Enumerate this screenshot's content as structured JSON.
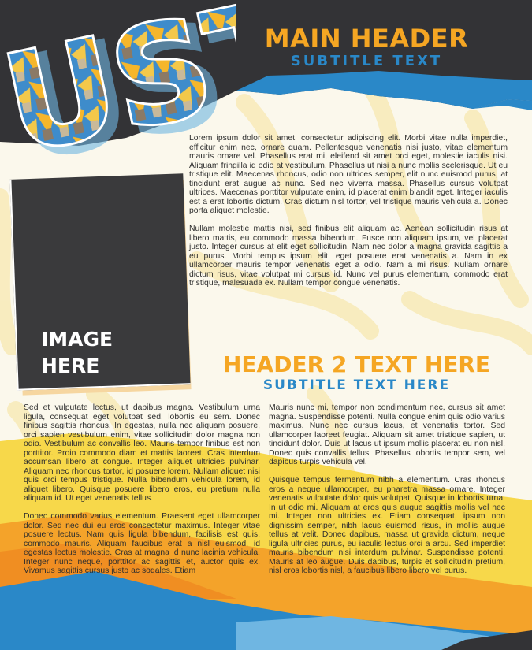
{
  "colors": {
    "accent_orange": "#f5a623",
    "accent_blue": "#2a88c8",
    "dark": "#333336",
    "background": "#fbf8ec"
  },
  "logo": {
    "text": "UST"
  },
  "header": {
    "title": "MAIN HEADER",
    "subtitle": "SUBTITLE TEXT"
  },
  "intro": {
    "paragraph1": "Lorem ipsum dolor sit amet, consectetur adipiscing elit. Morbi vitae nulla imperdiet, efficitur enim nec, ornare quam. Pellentesque venenatis nisi justo, vitae elementum mauris ornare vel. Phasellus erat mi, eleifend sit amet orci eget, molestie iaculis nisi. Aliquam fringilla id odio at vestibulum. Phasellus ut nisi a nunc mollis scelerisque. Ut eu tristique elit. Maecenas rhoncus, odio non ultrices semper, elit nunc euismod purus, at tincidunt erat augue ac nunc. Sed nec viverra massa. Phasellus cursus volutpat ultrices. Maecenas porttitor vulputate enim, id placerat enim blandit eget. Integer iaculis est a erat lobortis dictum. Cras dictum nisl tortor, vel tristique mauris vehicula a. Donec porta aliquet molestie.",
    "paragraph2": "Nullam molestie mattis nisi, sed finibus elit aliquam ac. Aenean sollicitudin risus at libero mattis, eu commodo massa bibendum. Fusce non aliquam ipsum, vel placerat justo. Integer cursus at elit eget sollicitudin. Nam nec dolor a magna gravida sagittis a eu purus. Morbi tempus ipsum elit, eget posuere erat venenatis a. Nam in ex ullamcorper mauris tempor venenatis eget a odio. Nam a mi risus. Nullam ornare dictum risus, vitae volutpat mi cursus id. Nunc vel purus elementum, commodo erat tristique, malesuada ex. Nullam tempor congue venenatis."
  },
  "image_placeholder": {
    "line1": "IMAGE",
    "line2": "HERE"
  },
  "header2": {
    "title": "HEADER 2 TEXT HERE",
    "subtitle": "SUBTITLE TEXT HERE"
  },
  "left_column": {
    "paragraph1": "Sed et vulputate lectus, ut dapibus magna. Vestibulum urna ligula, consequat eget volutpat sed, lobortis eu sem. Donec finibus sagittis rhoncus. In egestas, nulla nec aliquam posuere, orci sapien vestibulum enim, vitae sollicitudin dolor magna non odio. Vestibulum ac convallis leo. Mauris tempor finibus est non porttitor. Proin commodo diam et mattis laoreet. Cras interdum accumsan libero at congue. Integer aliquet ultricies pulvinar. Aliquam nec rhoncus tortor, id posuere lorem. Nullam aliquet nisi quis orci tempus tristique. Nulla bibendum vehicula lorem, id aliquet libero. Quisque posuere libero eros, eu pretium nulla aliquam id. Ut eget venenatis tellus.",
    "paragraph2": "Donec commodo varius elementum. Praesent eget ullamcorper dolor. Sed nec dui eu eros consectetur maximus. Integer vitae posuere lectus. Nam quis ligula bibendum, facilisis est quis, commodo mauris. Aliquam faucibus erat a nisl euismod, id egestas lectus molestie. Cras at magna id nunc lacinia vehicula. Integer nunc neque, porttitor ac sagittis et, auctor quis ex. Vivamus sagittis cursus justo ac sodales. Etiam"
  },
  "right_column": {
    "paragraph1": "Mauris nunc mi, tempor non condimentum nec, cursus sit amet magna. Suspendisse potenti. Nulla congue enim quis odio varius maximus. Nunc nec cursus lacus, et venenatis tortor. Sed ullamcorper laoreet feugiat. Aliquam sit amet tristique sapien, ut tincidunt dolor. Duis ut lacus ut ipsum mollis placerat eu non nisl. Donec quis convallis tellus. Phasellus lobortis tempor sem, vel dapibus turpis vehicula vel.",
    "paragraph2": "Quisque tempus fermentum nibh a elementum. Cras rhoncus eros a neque ullamcorper, eu pharetra massa ornare. Integer venenatis vulputate dolor quis volutpat. Quisque in lobortis urna. In ut odio mi. Aliquam at eros quis augue sagittis mollis vel nec mi. Integer non ultricies ex. Etiam consequat, ipsum non dignissim semper, nibh lacus euismod risus, in mollis augue tellus at velit. Donec dapibus, massa ut gravida dictum, neque ligula ultricies purus, eu iaculis lectus orci a arcu. Sed imperdiet mauris bibendum nisi interdum pulvinar. Suspendisse potenti. Mauris at leo augue. Duis dapibus, turpis et sollicitudin pretium, nisl eros lobortis nisl, a faucibus libero libero vel purus."
  }
}
